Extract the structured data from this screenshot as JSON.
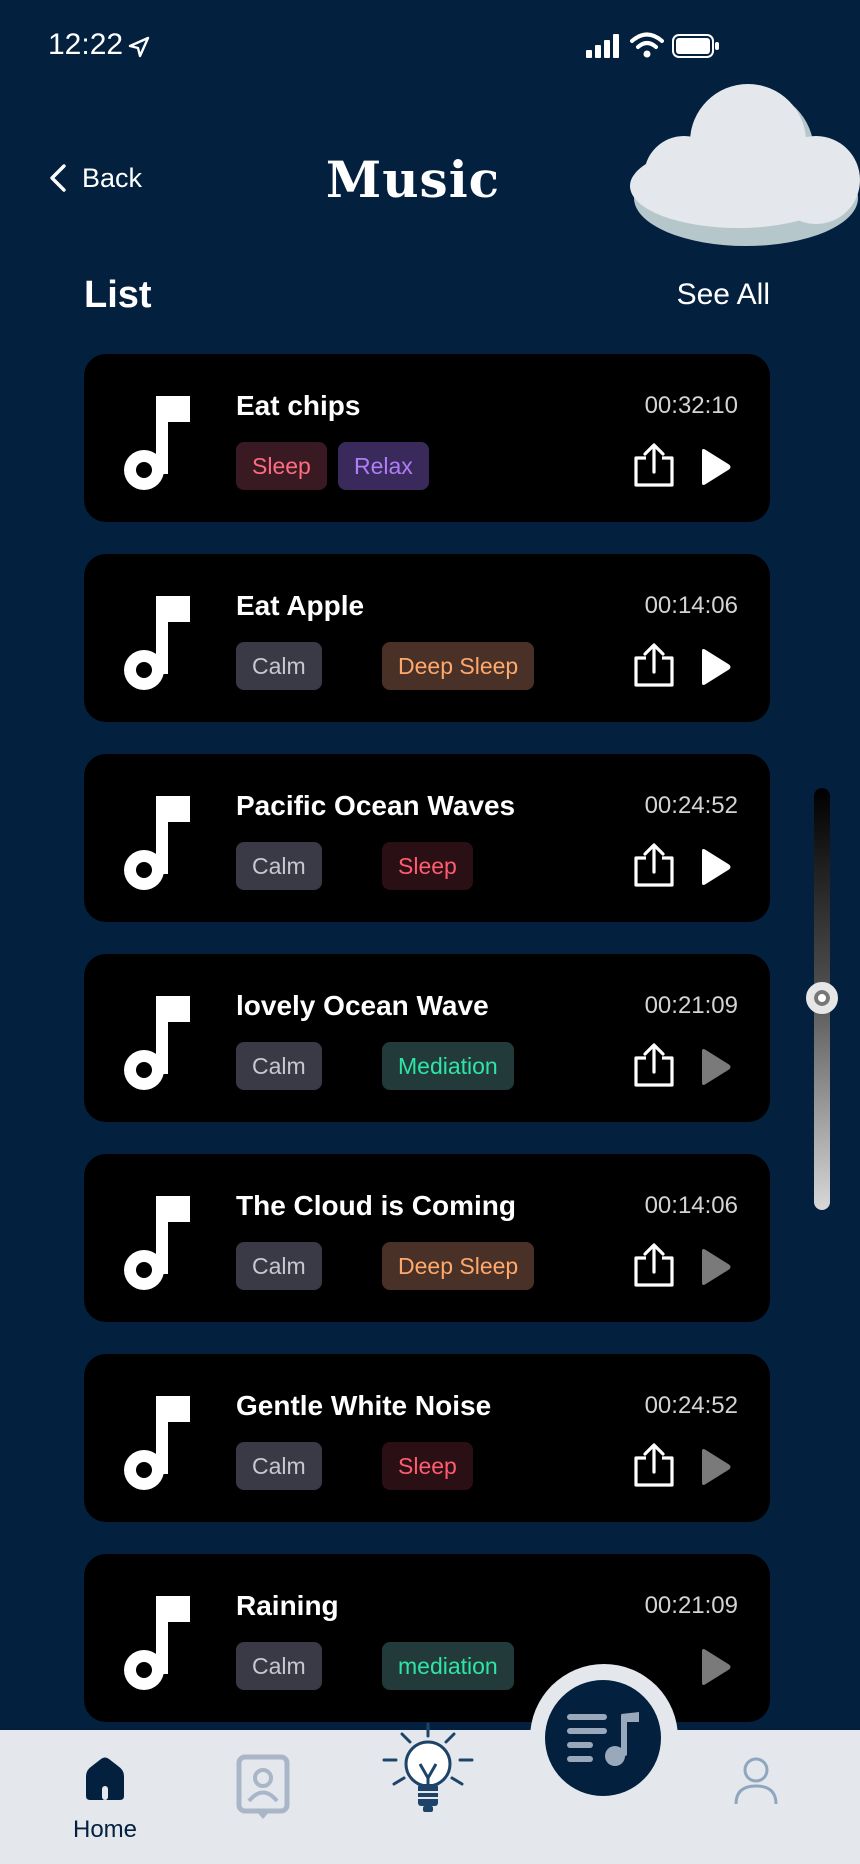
{
  "status_bar": {
    "time": "12:22"
  },
  "header": {
    "back_label": "Back",
    "title": "Music"
  },
  "list": {
    "heading": "List",
    "see_all": "See All"
  },
  "tracks": [
    {
      "title": "Eat chips",
      "duration": "00:32:10",
      "tags": [
        "Sleep",
        "Relax"
      ]
    },
    {
      "title": "Eat Apple",
      "duration": "00:14:06",
      "tags": [
        "Calm",
        "Deep Sleep"
      ]
    },
    {
      "title": "Pacific Ocean Waves",
      "duration": "00:24:52",
      "tags": [
        "Calm",
        "Sleep"
      ]
    },
    {
      "title": "lovely Ocean Wave",
      "duration": "00:21:09",
      "tags": [
        "Calm",
        "Mediation"
      ]
    },
    {
      "title": "The Cloud is Coming",
      "duration": "00:14:06",
      "tags": [
        "Calm",
        "Deep Sleep"
      ]
    },
    {
      "title": "Gentle White Noise",
      "duration": "00:24:52",
      "tags": [
        "Calm",
        "Sleep"
      ]
    },
    {
      "title": "Raining",
      "duration": "00:21:09",
      "tags": [
        "Calm",
        "mediation"
      ]
    }
  ],
  "tag_colors": {
    "Sleep": {
      "bg": "#3a1a22",
      "fg": "#ff6b81"
    },
    "Relax": {
      "bg": "#3a2a5c",
      "fg": "#b07cf7"
    },
    "Calm": {
      "bg": "#3a3a46",
      "fg": "#c8c8d0"
    },
    "Deep Sleep": {
      "bg": "#4a3128",
      "fg": "#ffa86b"
    },
    "Mediation": {
      "bg": "#233a3a",
      "fg": "#2ee5a6"
    },
    "mediation": {
      "bg": "#233a3a",
      "fg": "#2ee5a6"
    },
    "Sleep-dark": {
      "bg": "#2a0f14",
      "fg": "#ff5c70"
    }
  },
  "icons": {
    "back": "chevron-left-icon",
    "note": "music-note-icon",
    "share": "share-icon",
    "play": "play-icon",
    "fab": "playlist-icon"
  },
  "tab_bar": {
    "home_label": "Home"
  },
  "colors": {
    "background": "#03203f",
    "card": "#000000",
    "tab_bar": "#e4e8ec"
  }
}
